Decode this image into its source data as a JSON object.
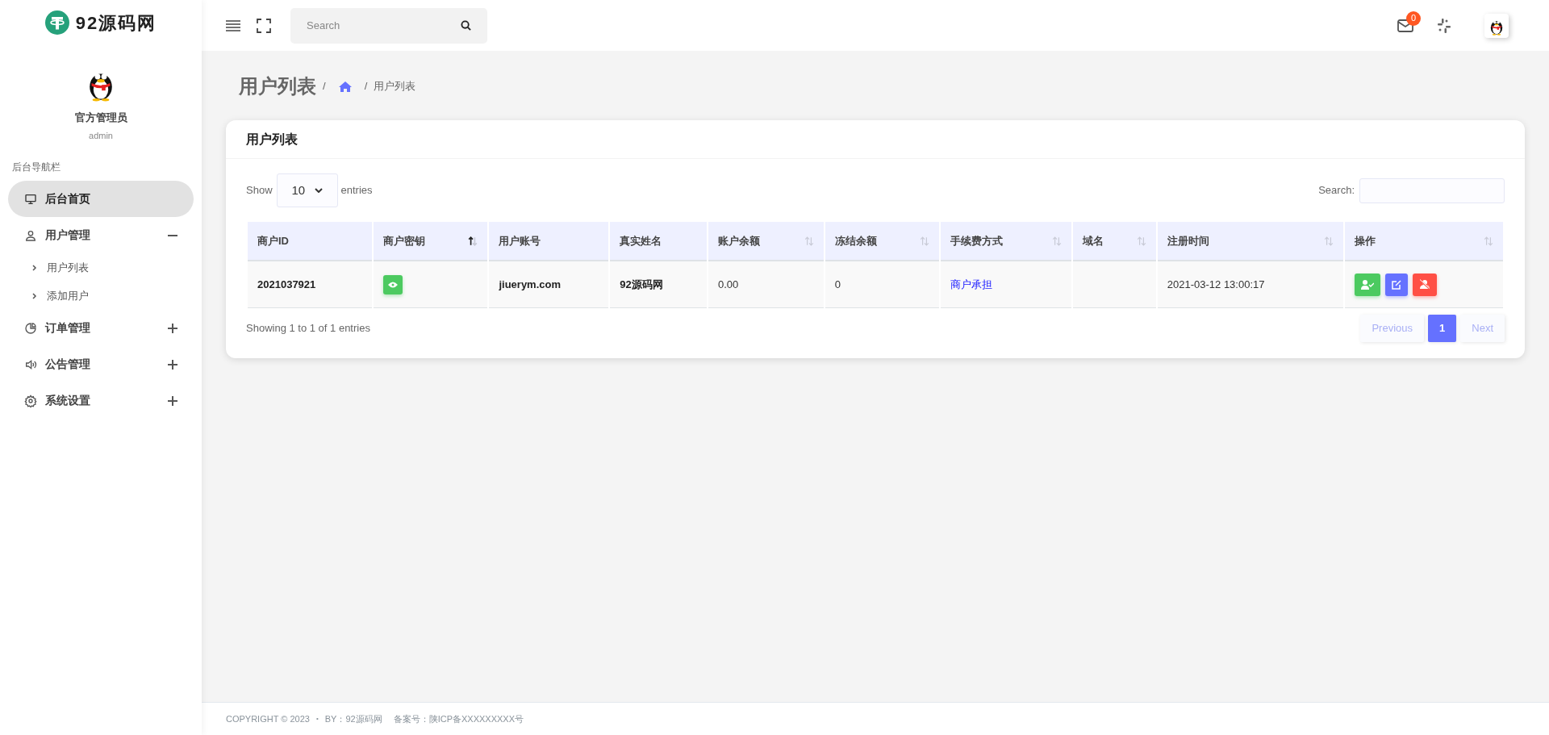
{
  "brand": {
    "name": "92源码网"
  },
  "profile": {
    "name": "官方管理员",
    "username": "admin"
  },
  "sidebar": {
    "section_title": "后台导航栏",
    "items": [
      {
        "label": "后台首页",
        "kind": "monitor",
        "selected": true
      },
      {
        "label": "用户管理",
        "kind": "user",
        "selected": false,
        "expanded": true,
        "children": [
          {
            "label": "用户列表",
            "selected": false
          },
          {
            "label": "添加用户",
            "selected": false
          }
        ]
      },
      {
        "label": "订单管理",
        "kind": "pie",
        "selected": false,
        "expanded": false
      },
      {
        "label": "公告管理",
        "kind": "speaker",
        "selected": false,
        "expanded": false
      },
      {
        "label": "系统设置",
        "kind": "gear",
        "selected": false,
        "expanded": false
      }
    ]
  },
  "topbar": {
    "search": {
      "placeholder": "Search"
    },
    "mail_badge": "0"
  },
  "page": {
    "title": "用户列表",
    "separator_1": "/",
    "separator_2": "/",
    "breadcrumb": [
      "用户列表"
    ]
  },
  "card": {
    "title": "用户列表",
    "show_label": "Show",
    "page_size": "10",
    "entries_label": "entries",
    "search_label": "Search:",
    "columns": [
      {
        "label": "商户ID",
        "sortable": false
      },
      {
        "label": "商户密钥",
        "sortable": true,
        "sorted": true
      },
      {
        "label": "用户账号",
        "sortable": false
      },
      {
        "label": "真实姓名",
        "sortable": false
      },
      {
        "label": "账户余额",
        "sortable": true,
        "sorted": false
      },
      {
        "label": "冻结余额",
        "sortable": true,
        "sorted": false
      },
      {
        "label": "手续费方式",
        "sortable": true,
        "sorted": false
      },
      {
        "label": "域名",
        "sortable": true,
        "sorted": false
      },
      {
        "label": "注册时间",
        "sortable": true,
        "sorted": false
      },
      {
        "label": "操作",
        "sortable": true,
        "sorted": false
      }
    ],
    "rows": [
      [
        {
          "kind": "bold",
          "text": "2021037921"
        },
        {
          "kind": "key"
        },
        {
          "kind": "bold",
          "text": "jiuerym.com"
        },
        {
          "kind": "bold",
          "text": "92源码网"
        },
        {
          "kind": "text",
          "text": "0.00"
        },
        {
          "kind": "text",
          "text": "0"
        },
        {
          "kind": "link",
          "text": "商户承担"
        },
        {
          "kind": "empty"
        },
        {
          "kind": "text",
          "text": "2021-03-12 13:00:17"
        },
        {
          "kind": "actions"
        }
      ]
    ],
    "info": "Showing 1 to 1 of 1 entries",
    "pagination": [
      {
        "label": "Previous",
        "kind": "nav",
        "disabled": true
      },
      {
        "label": "1",
        "kind": "page",
        "selected": true
      },
      {
        "label": "Next",
        "kind": "nav",
        "disabled": true
      }
    ]
  },
  "footer": {
    "copyright": "COPYRIGHT © 2023",
    "separator": "•",
    "by": "BY：92源码网",
    "icp": "备案号：陕ICP备XXXXXXXXX号"
  }
}
